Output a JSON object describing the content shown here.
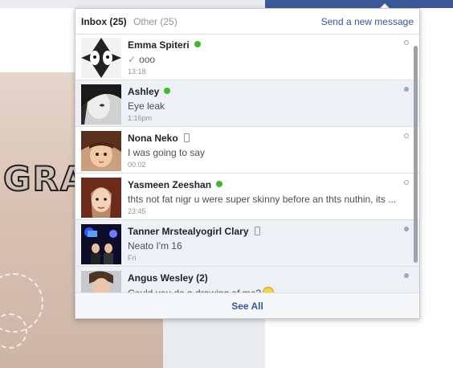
{
  "header": {
    "inbox_label": "Inbox (25)",
    "other_label": "Other (25)",
    "new_message_label": "Send a new message"
  },
  "background": {
    "photo_text": "GRA"
  },
  "messages": [
    {
      "name": "Emma Spiteri",
      "status": "online",
      "snippet": "ooo",
      "sent_mark": "✓",
      "time": "13:18",
      "unread": false
    },
    {
      "name": "Ashley",
      "status": "online",
      "snippet": "Eye leak",
      "time": "1:16pm",
      "unread": true
    },
    {
      "name": "Nona Neko",
      "status": "mobile",
      "snippet": "I was going to say",
      "time": "00:02",
      "unread": false
    },
    {
      "name": "Yasmeen Zeeshan",
      "status": "online",
      "snippet": "thts not fat nigr u were super skinny before an thts nuthin, its ...",
      "time": "23:45",
      "unread": false
    },
    {
      "name": "Tanner Mrstealyogirl Clary",
      "status": "mobile",
      "snippet": "Neato I'm 16",
      "time": "Fri",
      "unread": true
    },
    {
      "name": "Angus Wesley (2)",
      "status": "none",
      "snippet": "Could you do a drawing of me?",
      "time": "",
      "unread": true
    }
  ],
  "footer": {
    "see_all_label": "See All"
  },
  "colors": {
    "topbar": "#3b5998",
    "link": "#365899",
    "online": "#42b72a",
    "unread_bg": "#edf0f5"
  }
}
